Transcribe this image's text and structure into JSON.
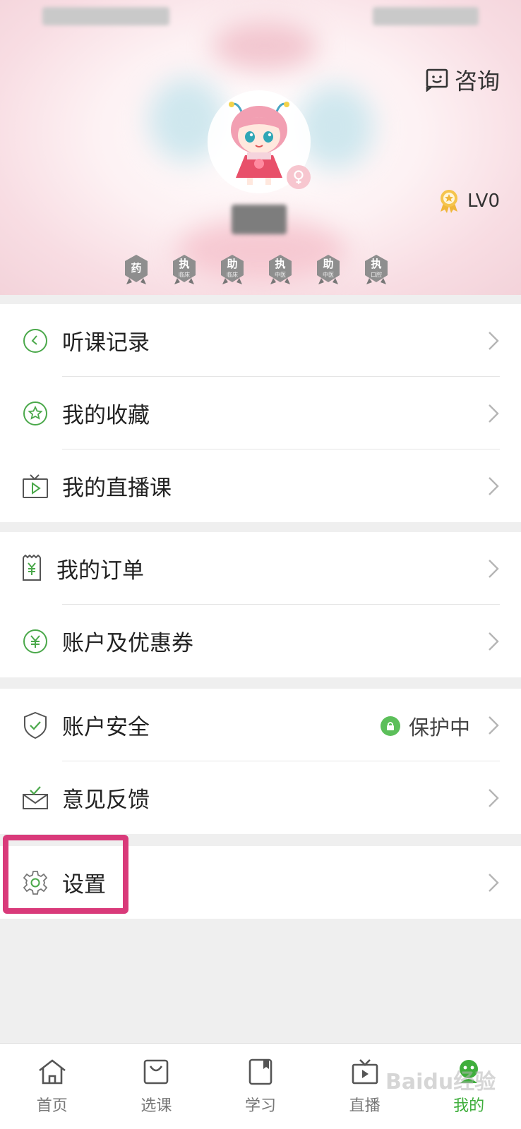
{
  "header": {
    "consult_label": "咨询",
    "level_label": "LV0",
    "medals": [
      {
        "main": "药",
        "sub": ""
      },
      {
        "main": "执",
        "sub": "临床"
      },
      {
        "main": "助",
        "sub": "临床"
      },
      {
        "main": "执",
        "sub": "中医"
      },
      {
        "main": "助",
        "sub": "中医"
      },
      {
        "main": "执",
        "sub": "口腔"
      }
    ]
  },
  "menu": {
    "listen_record": "听课记录",
    "favorites": "我的收藏",
    "live_courses": "我的直播课",
    "orders": "我的订单",
    "account_coupons": "账户及优惠券",
    "account_security": "账户安全",
    "security_status": "保护中",
    "feedback": "意见反馈",
    "settings": "设置"
  },
  "tabbar": {
    "home": "首页",
    "courses": "选课",
    "study": "学习",
    "live": "直播",
    "mine": "我的"
  },
  "colors": {
    "accent": "#3fae3c",
    "highlight": "#d93a7a",
    "medal": "#8e8e8e"
  },
  "watermark": "Baidu经验"
}
